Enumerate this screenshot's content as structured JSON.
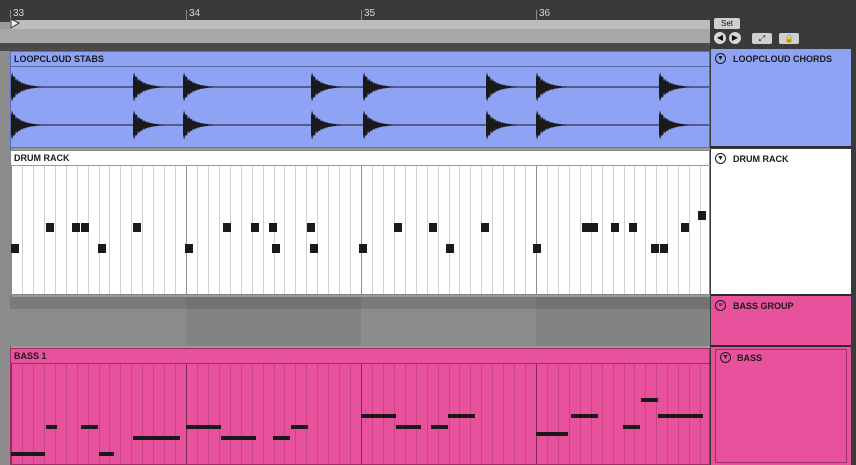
{
  "arrangement": {
    "bars": [
      "33",
      "34",
      "35",
      "36"
    ]
  },
  "transport": {
    "set_label": "Set",
    "nav_prev_icon": "arrow-left-icon",
    "nav_next_icon": "arrow-right-icon",
    "expand_icon": "expand-icon",
    "lock_icon": "lock-icon"
  },
  "tracks": [
    {
      "clip_name": "LOOPCLOUD STABS",
      "header_name": "LOOPCLOUD CHORDS",
      "color": "#8fa3f5",
      "kind": "audio"
    },
    {
      "clip_name": "DRUM RACK",
      "header_name": "DRUM RACK",
      "color": "#ffffff",
      "kind": "midi"
    },
    {
      "clip_name": "",
      "header_name": "BASS GROUP",
      "color": "#e8519b",
      "kind": "group"
    },
    {
      "clip_name": "BASS 1",
      "header_name": "BASS",
      "color": "#e8519b",
      "kind": "midi"
    }
  ]
}
